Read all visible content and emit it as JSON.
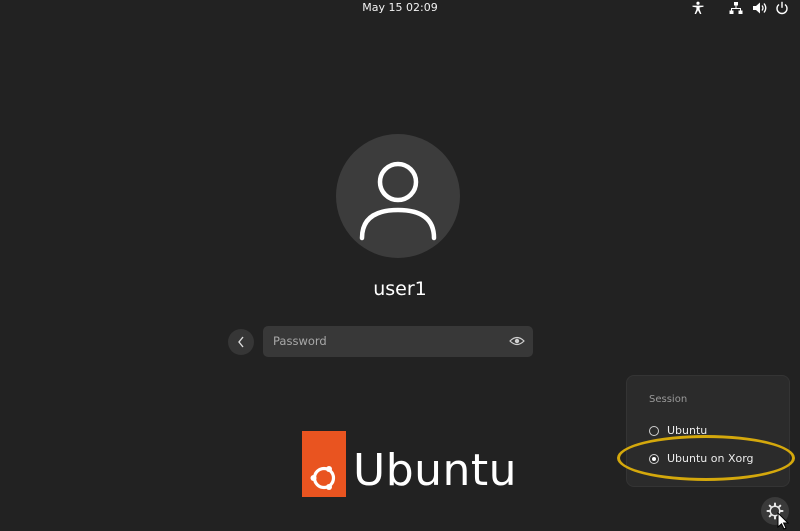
{
  "top_bar": {
    "clock": "May 15  02:09",
    "tray_icons": [
      "accessibility-icon",
      "network-icon",
      "volume-icon",
      "power-icon"
    ]
  },
  "login": {
    "avatar_icon": "user-avatar-icon",
    "username": "user1",
    "password_placeholder": "Password",
    "back_icon": "chevron-left-icon",
    "reveal_icon": "eye-icon"
  },
  "branding": {
    "logo_text": "Ubuntu",
    "logo_color": "#e95420"
  },
  "session_menu": {
    "title": "Session",
    "options": [
      {
        "label": "Ubuntu",
        "selected": false
      },
      {
        "label": "Ubuntu on Xorg",
        "selected": true
      }
    ],
    "annotation_color": "#d4a80c"
  },
  "settings_icon": "gear-icon"
}
